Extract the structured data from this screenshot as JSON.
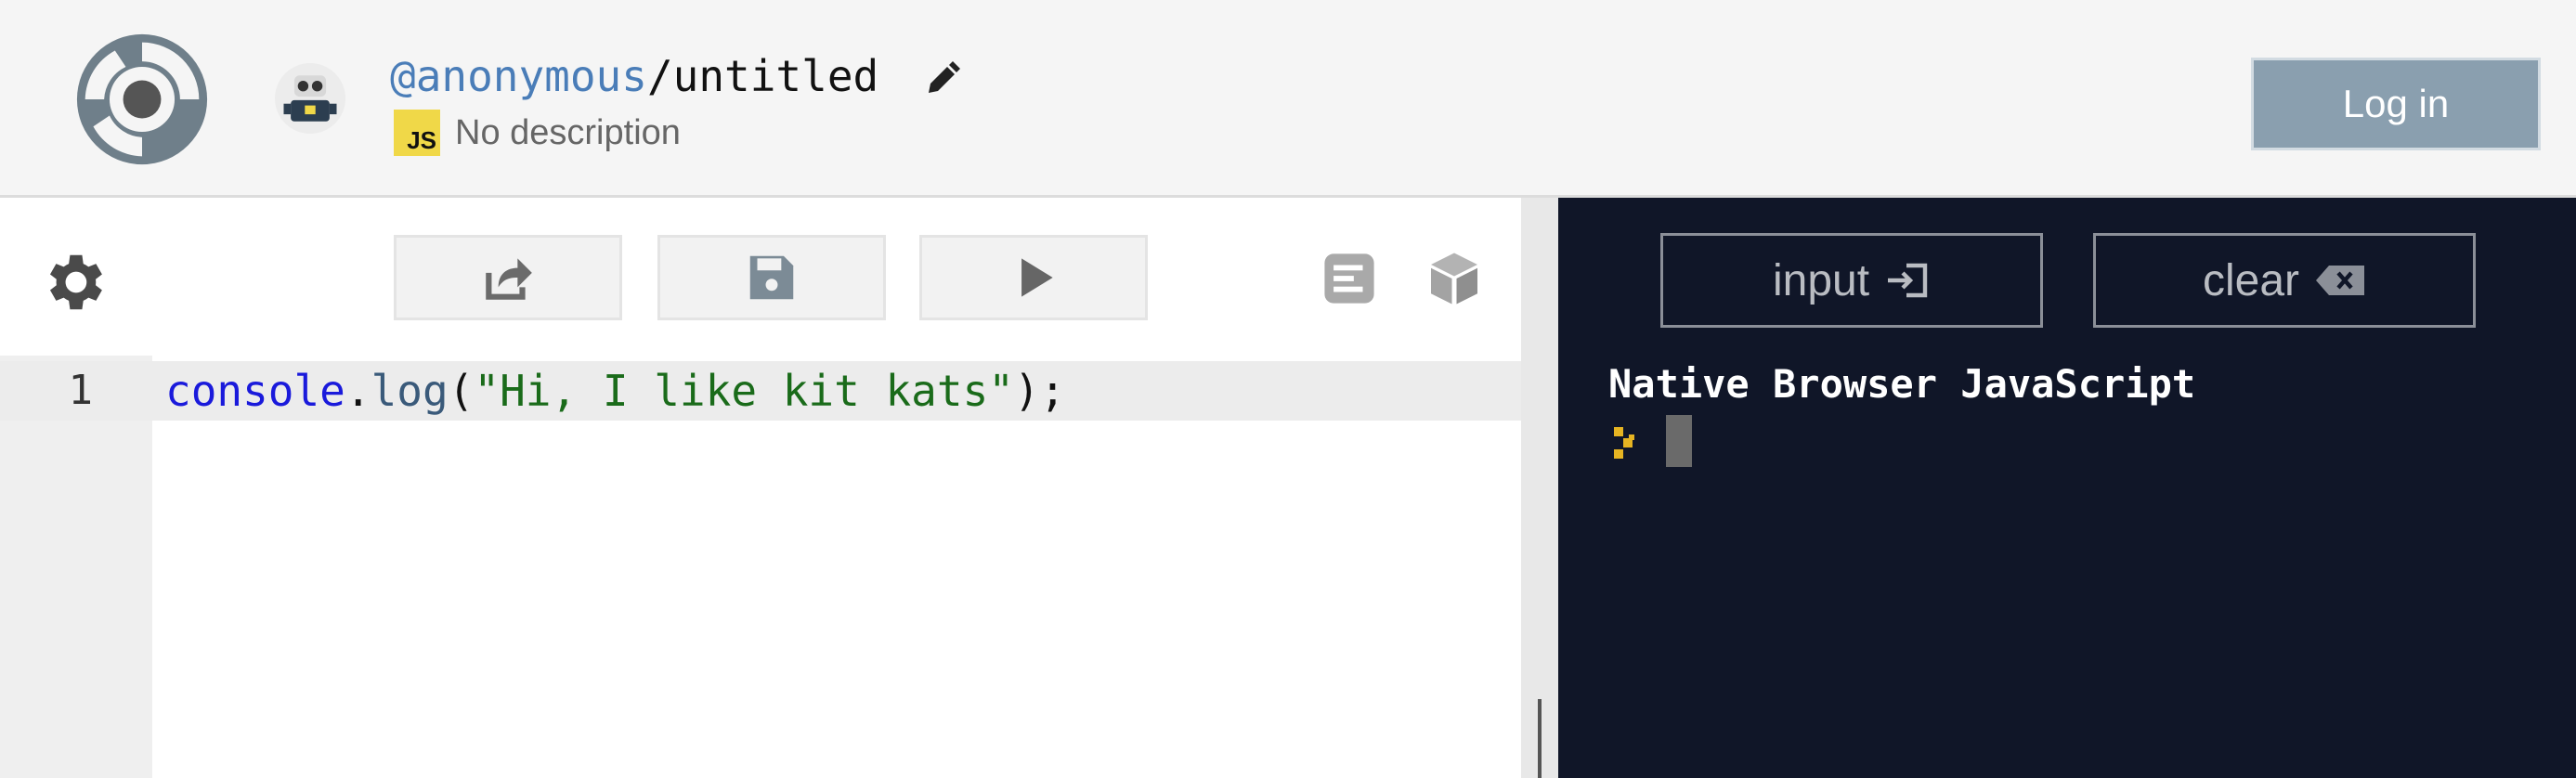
{
  "header": {
    "owner": "@anonymous",
    "separator": "/",
    "repl_name": "untitled",
    "language_badge": "JS",
    "description": "No description",
    "login_label": "Log in",
    "icons": [
      "repl-logo-icon",
      "robot-avatar-icon",
      "pencil-icon"
    ]
  },
  "editor": {
    "toolbar_icons": [
      "gear-icon",
      "share-icon",
      "save-icon",
      "run-icon",
      "format-icon",
      "package-icon"
    ],
    "line_number": "1",
    "code_tokens": {
      "object": "console",
      "dot": ".",
      "method": "log",
      "open_paren": "(",
      "string": "\"Hi, I like kit kats\"",
      "close": ");"
    }
  },
  "console": {
    "input_label": "input",
    "clear_label": "clear",
    "banner": "Native Browser JavaScript",
    "prompt_icon": "prompt-chevron-icon"
  },
  "colors": {
    "console_bg": "#101628",
    "login_bg": "#8a9faf",
    "owner_link": "#4a7db8",
    "js_badge": "#f0d848"
  }
}
